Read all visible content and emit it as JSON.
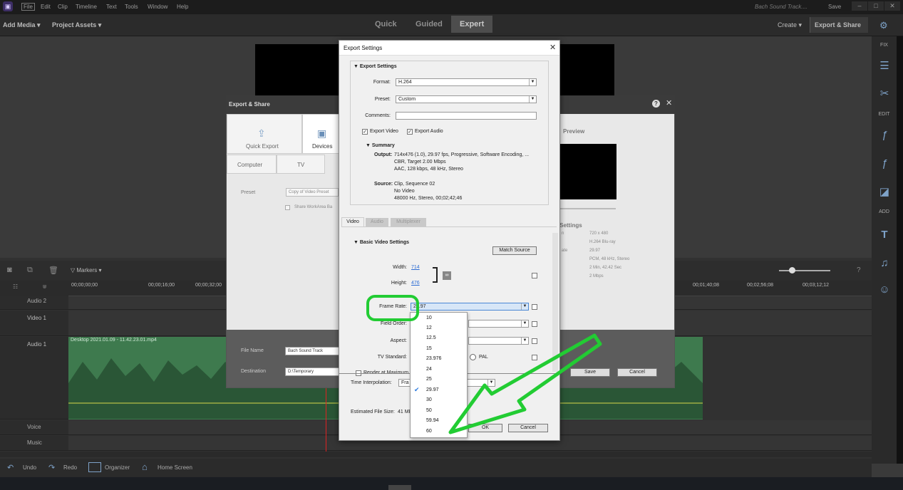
{
  "menubar": {
    "logo": "▣",
    "items": [
      "File",
      "Edit",
      "Clip",
      "Timeline",
      "Text",
      "Tools",
      "Window",
      "Help"
    ],
    "project_title": "Bach Sound Track....",
    "save": "Save"
  },
  "topbar": {
    "add_media": "Add Media",
    "project_assets": "Project Assets",
    "modes": [
      "Quick",
      "Guided",
      "Expert"
    ],
    "create": "Create",
    "export_share": "Export & Share"
  },
  "right_panel": {
    "fix": "FIX",
    "edit": "EDIT",
    "add": "ADD"
  },
  "timeline": {
    "markers": "Markers",
    "timecodes": [
      "00;00;00;00",
      "00;00;16;00",
      "00;00;32;00",
      "00;01;40;08",
      "00;02;56;08",
      "00;03;12;12"
    ],
    "tracks": {
      "audio2": "Audio 2",
      "video1": "Video 1",
      "audio1": "Audio 1",
      "voice": "Voice",
      "music": "Music"
    },
    "clip_name": "Desktop 2021.01.09 - 11.42.23.01.mp4"
  },
  "bottombar": {
    "undo": "Undo",
    "redo": "Redo",
    "organizer": "Organizer",
    "home": "Home Screen"
  },
  "export_share": {
    "title": "Export & Share",
    "tabs": [
      "Quick Export",
      "Devices"
    ],
    "subtabs": [
      "Computer",
      "TV"
    ],
    "preset_label": "Preset",
    "preset_value": "Copy of Video Preset",
    "share_workarea": "Share WorkArea Ba",
    "preview": "Preview",
    "settings_head": "n Settings",
    "settings_labels": [
      "n",
      "",
      "ate",
      "",
      "",
      ""
    ],
    "settings_values": [
      "720 x 480",
      "H.264 Blu-ray",
      "29.97",
      "PCM, 48 kHz, Stereo",
      "2 Min, 42.42 Sec",
      "2 Mbps"
    ],
    "file_name_label": "File Name",
    "file_name": "Bach Sound Track",
    "destination_label": "Destination",
    "destination": "D:\\Temporary",
    "save": "Save",
    "cancel": "Cancel"
  },
  "export_settings": {
    "title": "Export Settings",
    "section": "Export Settings",
    "format_label": "Format:",
    "format": "H.264",
    "preset_label": "Preset:",
    "preset": "Custom",
    "comments_label": "Comments:",
    "export_video": "Export Video",
    "export_audio": "Export Audio",
    "summary": "Summary",
    "output_label": "Output:",
    "output_lines": [
      "714x476 (1.0), 29.97 fps, Progressive, Software Encoding, ...",
      "CBR, Target 2.00 Mbps",
      "AAC, 128 kbps, 48 kHz, Stereo"
    ],
    "source_label": "Source:",
    "source_lines": [
      "Clip, Sequence 02",
      "No Video",
      "48000 Hz, Stereo, 00;02;42;46"
    ],
    "tabs": [
      "Video",
      "Audio",
      "Multiplexer"
    ],
    "basic_video": "Basic Video Settings",
    "match_source": "Match Source",
    "width_label": "Width:",
    "width": "714",
    "height_label": "Height:",
    "height": "476",
    "frame_rate_label": "Frame Rate:",
    "frame_rate": "29.97",
    "field_order_label": "Field Order:",
    "aspect_label": "Aspect:",
    "tv_standard_label": "TV Standard:",
    "pal": "PAL",
    "render_max": "Render at Maximum",
    "time_interp_label": "Time Interpolation:",
    "time_interp": "Fra",
    "est_size_label": "Estimated File Size:",
    "est_size": "41 MB",
    "ok": "OK",
    "cancel": "Cancel"
  },
  "frame_rate_options": [
    "10",
    "12",
    "12.5",
    "15",
    "23.976",
    "24",
    "25",
    "29.97",
    "30",
    "50",
    "59.94",
    "60"
  ],
  "selected_frame_rate": "29.97",
  "colors": {
    "highlight_green": "#22cc33",
    "clip_green": "#3e7a4e",
    "link_blue": "#2b6cd4"
  }
}
